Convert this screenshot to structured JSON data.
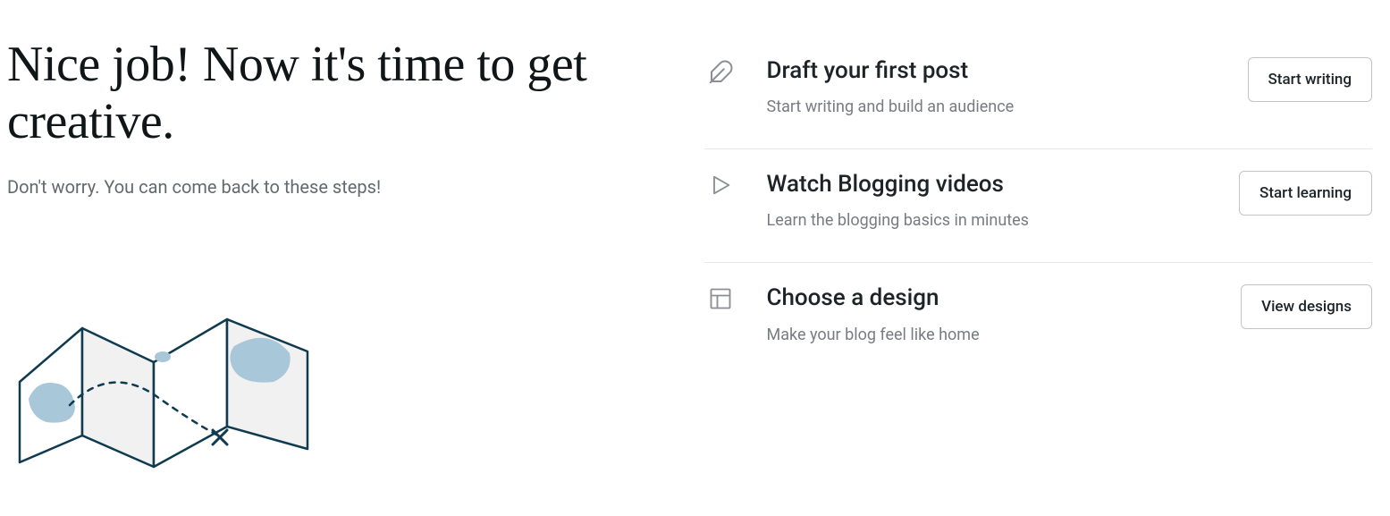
{
  "hero": {
    "headline": "Nice job! Now it's time to get creative.",
    "sub": "Don't worry. You can come back to these steps!"
  },
  "tasks": [
    {
      "title": "Draft your first post",
      "desc": "Start writing and build an audience",
      "button": "Start writing"
    },
    {
      "title": "Watch Blogging videos",
      "desc": "Learn the blogging basics in minutes",
      "button": "Start learning"
    },
    {
      "title": "Choose a design",
      "desc": "Make your blog feel like home",
      "button": "View designs"
    }
  ]
}
